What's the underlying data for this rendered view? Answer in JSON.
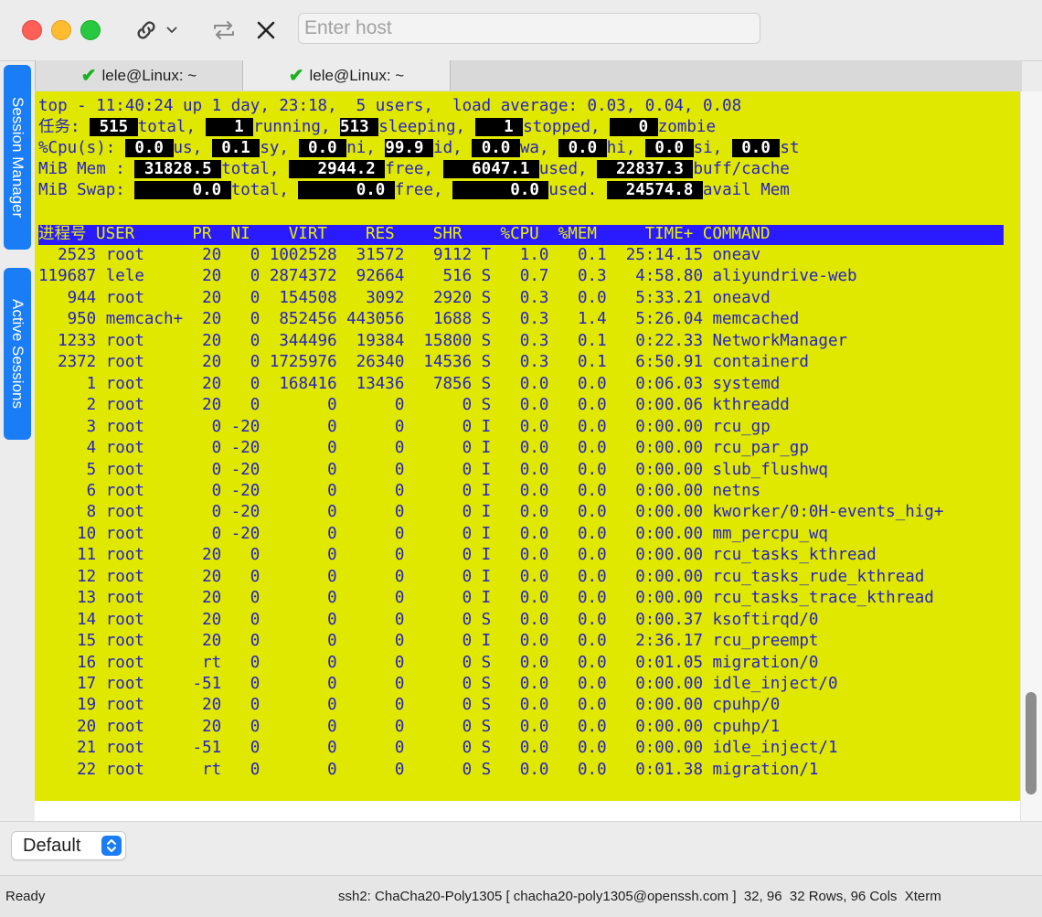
{
  "toolbar": {
    "host_placeholder": "Enter host",
    "icons": [
      "link-icon",
      "chevron-down-icon",
      "reconnect-icon",
      "close-icon"
    ]
  },
  "sidebar": {
    "session_manager": "Session Manager",
    "active_sessions": "Active Sessions"
  },
  "tabs": [
    {
      "label": "lele@Linux: ~",
      "status": "connected"
    },
    {
      "label": "lele@Linux: ~",
      "status": "connected"
    }
  ],
  "terminal": {
    "summary": [
      "top - 11:40:24 up 1 day, 23:18,  5 users,  load average: 0.03, 0.04, 0.08",
      "任务: 515 total,   1 running, 513 sleeping,   1 stopped,   0 zombie",
      "%Cpu(s):  0.0 us,  0.1 sy,  0.0 ni, 99.9 id,  0.0 wa,  0.0 hi,  0.0 si,  0.0 st",
      "MiB Mem :  31828.5 total,   2944.2 free,   6047.1 used,  22837.3 buff/cache",
      "MiB Swap:      0.0 total,      0.0 free,      0.0 used.  24574.8 avail Mem"
    ],
    "header": "进程号 USER      PR  NI    VIRT    RES    SHR    %CPU  %MEM     TIME+ COMMAND",
    "processes": [
      "  2523 root      20   0 1002528  31572   9112 T   1.0   0.1  25:14.15 oneav",
      "119687 lele      20   0 2874372  92664    516 S   0.7   0.3   4:58.80 aliyundrive-web",
      "   944 root      20   0  154508   3092   2920 S   0.3   0.0   5:33.21 oneavd",
      "   950 memcach+  20   0  852456 443056   1688 S   0.3   1.4   5:26.04 memcached",
      "  1233 root      20   0  344496  19384  15800 S   0.3   0.1   0:22.33 NetworkManager",
      "  2372 root      20   0 1725976  26340  14536 S   0.3   0.1   6:50.91 containerd",
      "     1 root      20   0  168416  13436   7856 S   0.0   0.0   0:06.03 systemd",
      "     2 root      20   0       0      0      0 S   0.0   0.0   0:00.06 kthreadd",
      "     3 root       0 -20       0      0      0 I   0.0   0.0   0:00.00 rcu_gp",
      "     4 root       0 -20       0      0      0 I   0.0   0.0   0:00.00 rcu_par_gp",
      "     5 root       0 -20       0      0      0 I   0.0   0.0   0:00.00 slub_flushwq",
      "     6 root       0 -20       0      0      0 I   0.0   0.0   0:00.00 netns",
      "     8 root       0 -20       0      0      0 I   0.0   0.0   0:00.00 kworker/0:0H-events_hig+",
      "    10 root       0 -20       0      0      0 I   0.0   0.0   0:00.00 mm_percpu_wq",
      "    11 root      20   0       0      0      0 I   0.0   0.0   0:00.00 rcu_tasks_kthread",
      "    12 root      20   0       0      0      0 I   0.0   0.0   0:00.00 rcu_tasks_rude_kthread",
      "    13 root      20   0       0      0      0 I   0.0   0.0   0:00.00 rcu_tasks_trace_kthread",
      "    14 root      20   0       0      0      0 S   0.0   0.0   0:00.37 ksoftirqd/0",
      "    15 root      20   0       0      0      0 I   0.0   0.0   2:36.17 rcu_preempt",
      "    16 root      rt   0       0      0      0 S   0.0   0.0   0:01.05 migration/0",
      "    17 root     -51   0       0      0      0 S   0.0   0.0   0:00.00 idle_inject/0",
      "    19 root      20   0       0      0      0 S   0.0   0.0   0:00.00 cpuhp/0",
      "    20 root      20   0       0      0      0 S   0.0   0.0   0:00.00 cpuhp/1",
      "    21 root     -51   0       0      0      0 S   0.0   0.0   0:00.00 idle_inject/1",
      "    22 root      rt   0       0      0      0 S   0.0   0.0   0:01.38 migration/1"
    ]
  },
  "profile": {
    "selected": "Default"
  },
  "status": {
    "left": "Ready",
    "right": "ssh2: ChaCha20-Poly1305 [ chacha20-poly1305@openssh.com ]  32, 96  32 Rows, 96 Cols  Xterm"
  },
  "colors": {
    "terminal_bg": "#e1e800",
    "terminal_fg": "#2521c8",
    "header_bar": "#2a1bff",
    "accent": "#1a7df5"
  }
}
